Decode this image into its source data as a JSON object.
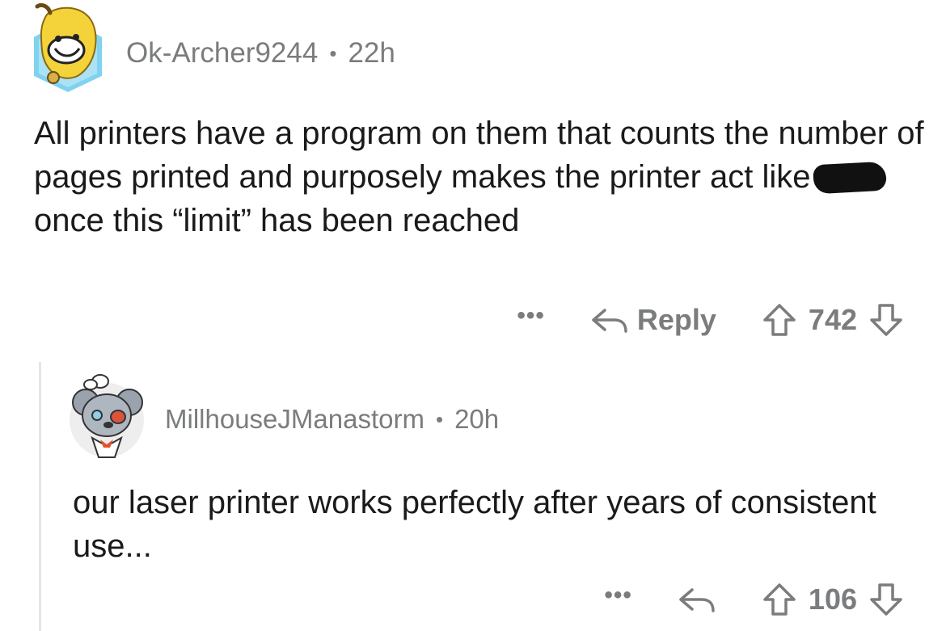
{
  "comments": [
    {
      "username": "Ok-Archer9244",
      "separator": "•",
      "time": "22h",
      "body_part1": "All printers have a program on them that counts the number of pages printed and purposely makes the printer act like s",
      "body_part2": "once this “limit” has been reached",
      "more": "•••",
      "reply_label": "Reply",
      "score": "742"
    },
    {
      "username": "MillhouseJManastorm",
      "separator": "•",
      "time": "20h",
      "body": "our laser printer works perfectly after years of consistent use...",
      "more": "•••",
      "score": "106"
    }
  ],
  "icons": {
    "reply": "reply-arrow-icon",
    "upvote": "upvote-arrow-icon",
    "downvote": "downvote-arrow-icon"
  },
  "colors": {
    "meta_gray": "#7a7c7e",
    "text": "#1a1a1b",
    "thread_line": "#e5e5e5"
  }
}
